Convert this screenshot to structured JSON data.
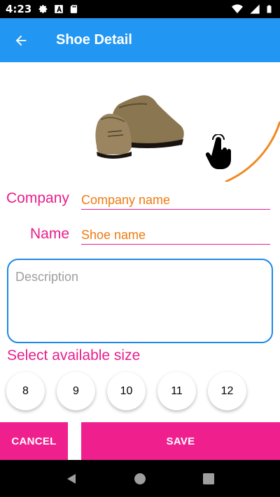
{
  "status_bar": {
    "time": "4:23",
    "left_icons": [
      "gear-icon",
      "a-badge-icon",
      "sd-card-icon"
    ],
    "right_icons": [
      "wifi-icon",
      "signal-icon",
      "battery-icon"
    ]
  },
  "app_bar": {
    "title": "Shoe Detail",
    "back_icon": "arrow-left-icon",
    "color": "#2196f3"
  },
  "image_area": {
    "image": "brown-suede-shoes",
    "overlay_icon": "tap-hand-icon",
    "arc_color": "#f08a24"
  },
  "form": {
    "company_label": "Company",
    "company_placeholder": "Company name",
    "name_label": "Name",
    "name_placeholder": "Shoe name",
    "description_placeholder": "Description",
    "accent_color": "#e91e8c"
  },
  "sizes": {
    "label": "Select available size",
    "options": [
      "8",
      "9",
      "10",
      "11",
      "12"
    ]
  },
  "buttons": {
    "cancel": "CANCEL",
    "save": "SAVE",
    "color": "#ef1f8e"
  },
  "nav_bar": {
    "icons": [
      "back-triangle-icon",
      "home-circle-icon",
      "recents-square-icon"
    ]
  }
}
